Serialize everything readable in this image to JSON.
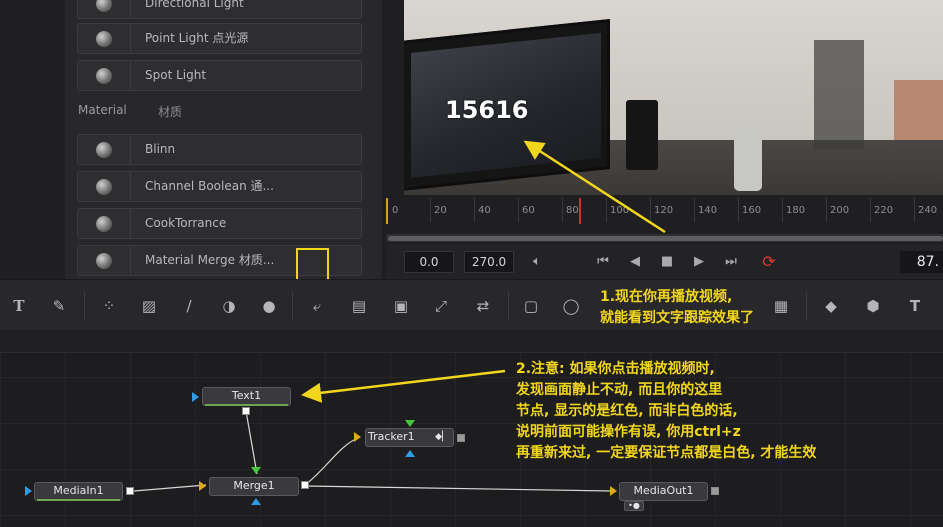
{
  "library": {
    "items": [
      {
        "label": "Directional Light"
      },
      {
        "label": "Point Light 点光源"
      },
      {
        "label": "Spot Light"
      },
      {
        "label": "Blinn"
      },
      {
        "label": "Channel Boolean 通..."
      },
      {
        "label": "CookTorrance"
      },
      {
        "label": "Material Merge 材质..."
      }
    ],
    "category": "Material",
    "category_cn": "材质"
  },
  "viewer": {
    "tracked_text": "15616"
  },
  "ruler": {
    "ticks": [
      "0",
      "20",
      "40",
      "60",
      "80",
      "100",
      "120",
      "140",
      "160",
      "180",
      "200",
      "220",
      "240"
    ]
  },
  "transport": {
    "start_time": "0.0",
    "end_time": "270.0",
    "current_frame": "87."
  },
  "nodes": {
    "text1": "Text1",
    "tracker1": "Tracker1",
    "merge1": "Merge1",
    "mediain1": "MediaIn1",
    "mediaout1": "MediaOut1"
  },
  "annotations": {
    "note1": [
      "1.现在你再播放视频,",
      "就能看到文字跟踪效果了"
    ],
    "note2": [
      "2.注意: 如果你点击播放视频时,",
      "发现画面静止不动, 而且你的这里",
      "节点, 显示的是红色, 而非白色的话,",
      "说明前面可能操作有误, 你用ctrl+z",
      "再重新来过, 一定要保证节点都是白色, 才能生效"
    ]
  },
  "colors": {
    "annotation": "#f2d61c",
    "node_bar": "#6aa84f",
    "playhead": "#c8342e",
    "loop_icon": "#e0392f"
  }
}
